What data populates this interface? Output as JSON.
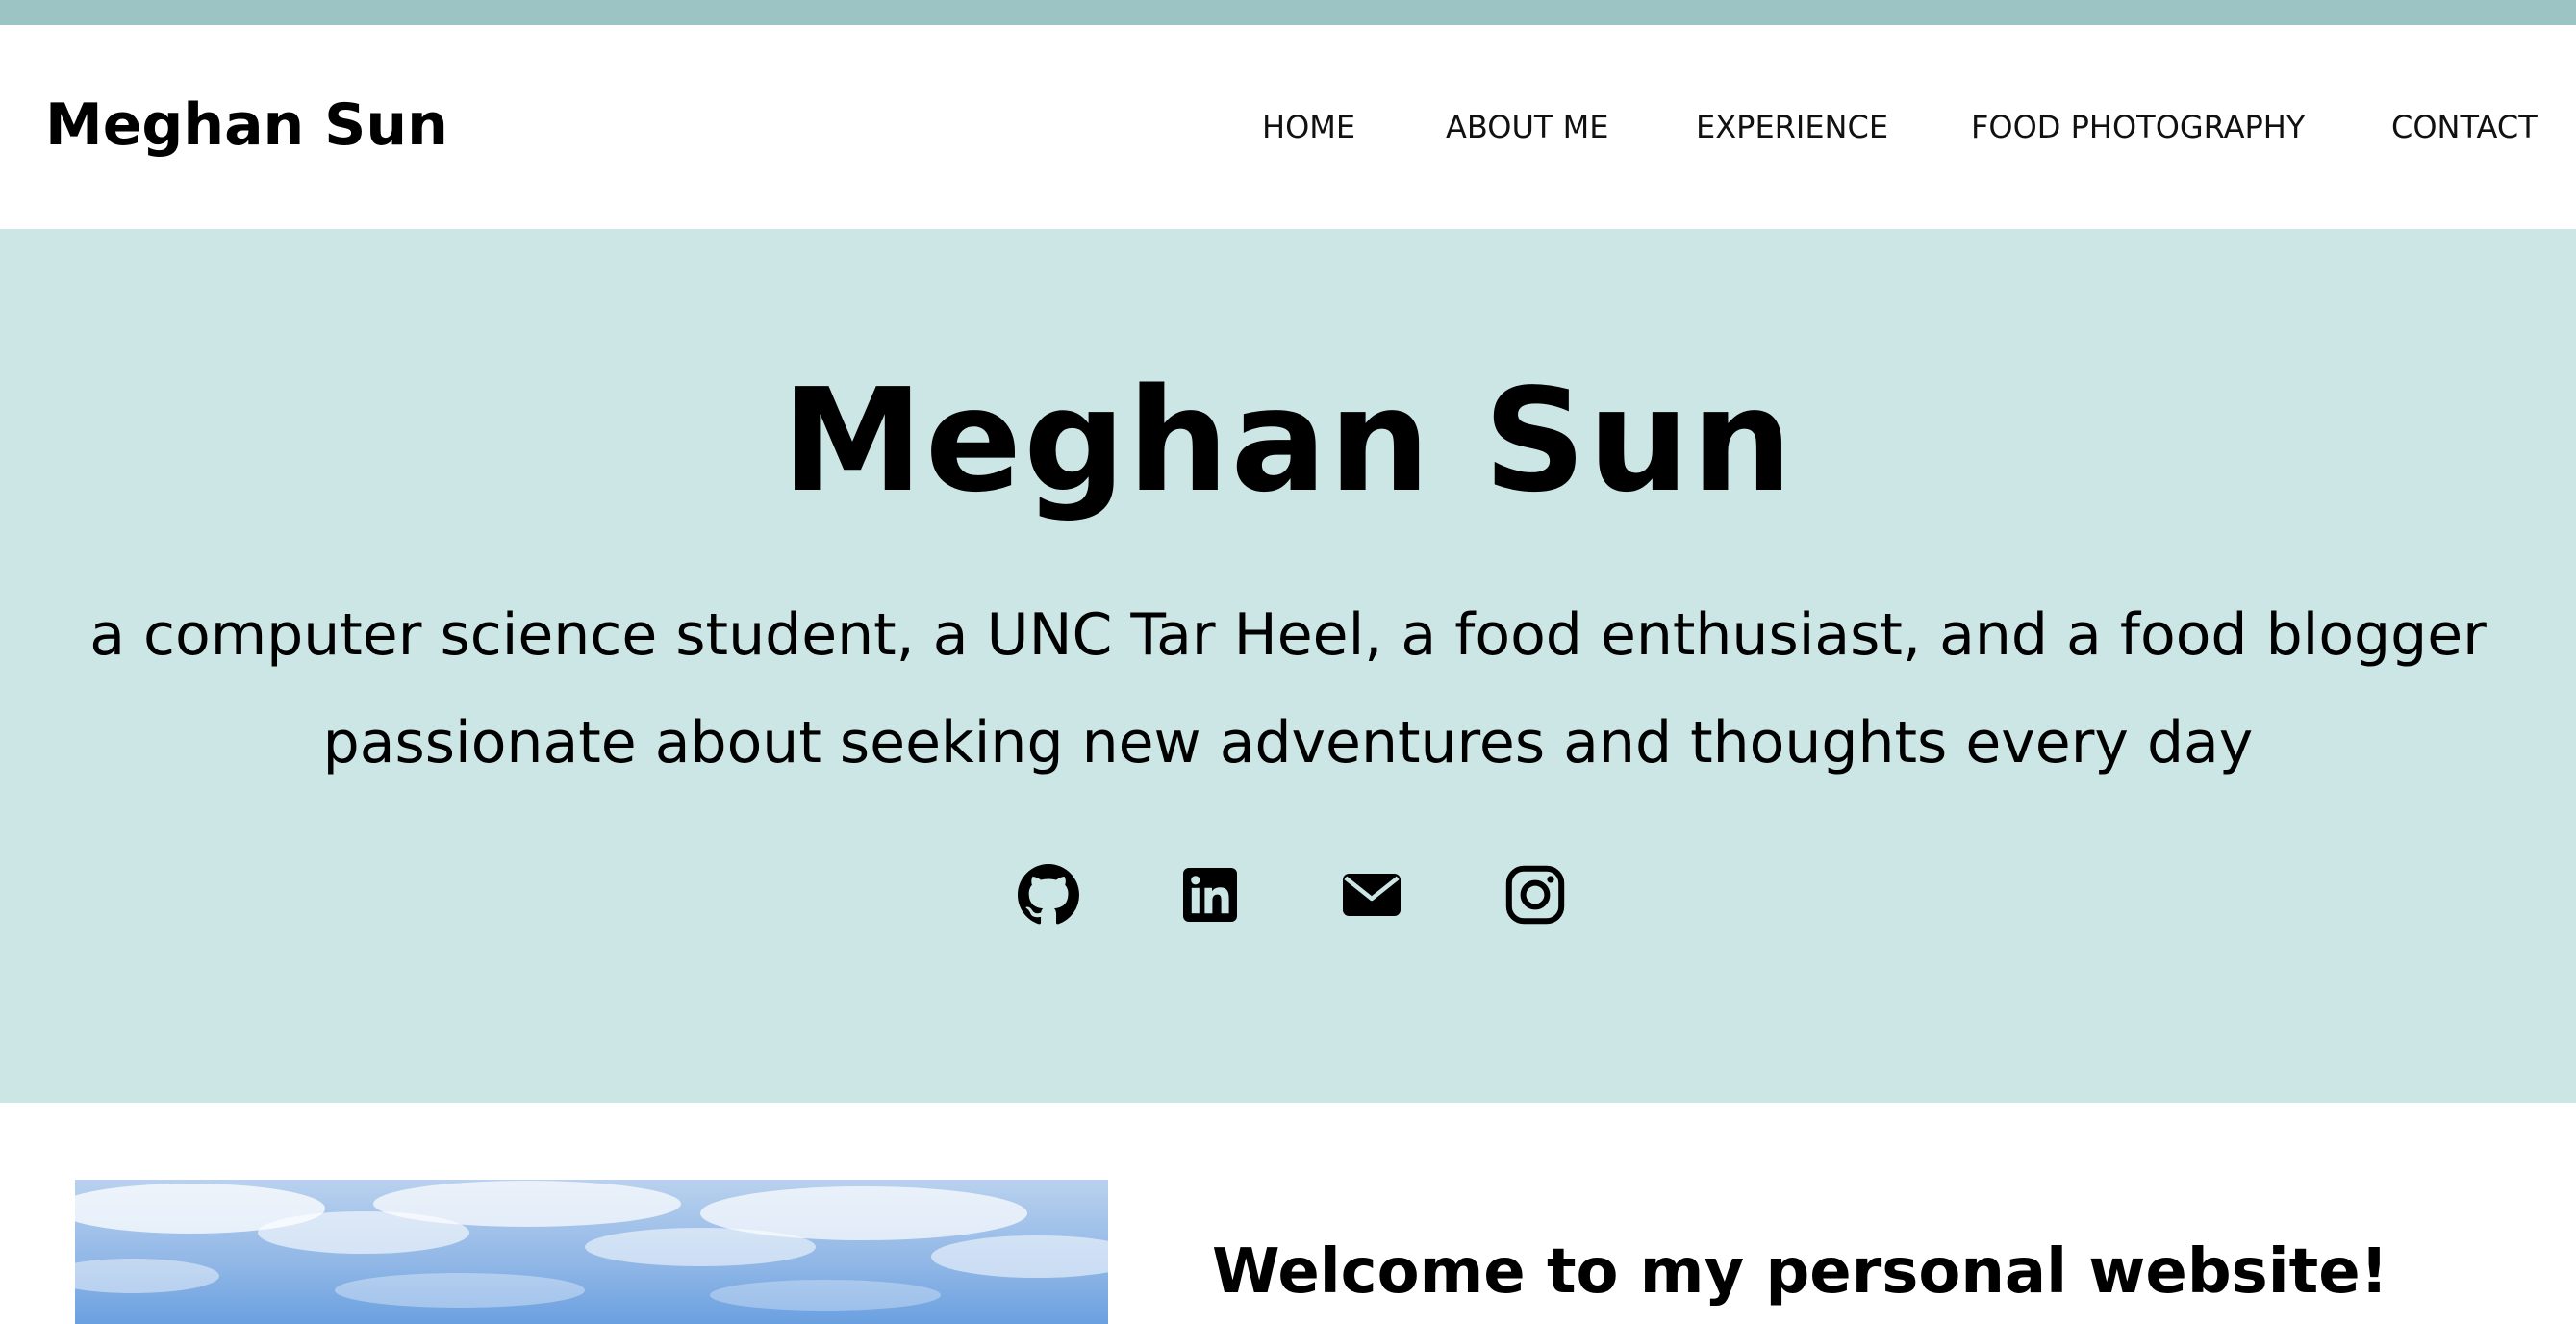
{
  "header": {
    "brand": "Meghan Sun",
    "nav": [
      {
        "label": "HOME"
      },
      {
        "label": "ABOUT ME"
      },
      {
        "label": "EXPERIENCE"
      },
      {
        "label": "FOOD PHOTOGRAPHY"
      },
      {
        "label": "CONTACT"
      }
    ]
  },
  "hero": {
    "title": "Meghan Sun",
    "tagline_line1": "a computer science student, a UNC Tar Heel, a food enthusiast, and a food blogger",
    "tagline_line2": "passionate about seeking new adventures and thoughts every day",
    "social_icons": [
      "github-icon",
      "linkedin-icon",
      "email-icon",
      "instagram-icon"
    ]
  },
  "main": {
    "welcome_heading": "Welcome to my personal website!",
    "photo": "sky-photo"
  },
  "colors": {
    "top_stripe": "#9cc4c4",
    "hero_background": "#cce6e5",
    "page_background": "#ffffff",
    "text": "#000000"
  }
}
